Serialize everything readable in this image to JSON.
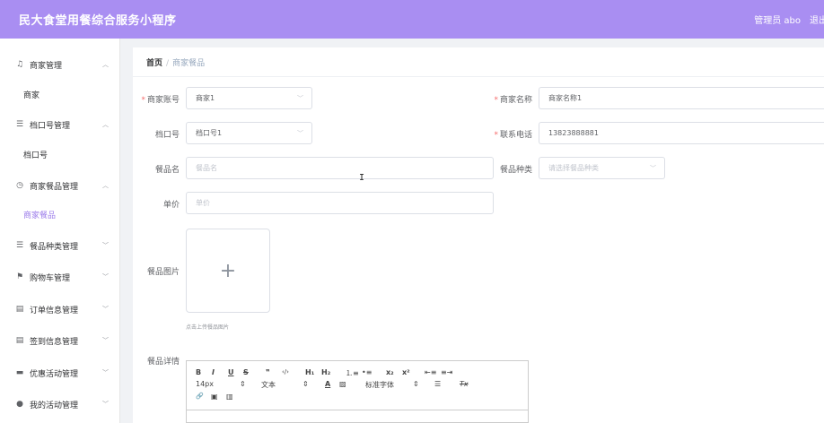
{
  "header": {
    "title": "民大食堂用餐综合服务小程序",
    "user": "管理员 abo",
    "logout": "退出"
  },
  "sidebar": {
    "items": [
      {
        "label": "商家管理",
        "icon": "bell-icon",
        "glyph": "♫",
        "arrow": "︿"
      },
      {
        "label": "档口号管理",
        "icon": "menu-icon",
        "glyph": "☰",
        "arrow": "︿"
      },
      {
        "label": "商家餐品管理",
        "icon": "clock-icon",
        "glyph": "◷",
        "arrow": "︿"
      },
      {
        "label": "餐品种类管理",
        "icon": "list-icon",
        "glyph": "☰",
        "arrow": "﹀"
      },
      {
        "label": "购物车管理",
        "icon": "flag-icon",
        "glyph": "⚑",
        "arrow": "﹀"
      },
      {
        "label": "订单信息管理",
        "icon": "document-icon",
        "glyph": "▤",
        "arrow": "﹀"
      },
      {
        "label": "签到信息管理",
        "icon": "checkin-icon",
        "glyph": "▤",
        "arrow": "﹀"
      },
      {
        "label": "优惠活动管理",
        "icon": "coupon-icon",
        "glyph": "▬",
        "arrow": "﹀"
      },
      {
        "label": "我的活动管理",
        "icon": "location-icon",
        "glyph": "●",
        "arrow": "﹀"
      }
    ],
    "subitems": {
      "merchant": "商家",
      "stall": "档口号",
      "merchant_dish": "商家餐品"
    }
  },
  "breadcrumb": {
    "home": "首页",
    "separator": "/",
    "current": "商家餐品"
  },
  "form": {
    "merchant_account": {
      "label": "商家账号",
      "value": "商家1"
    },
    "merchant_name": {
      "label": "商家名称",
      "value": "商家名称1"
    },
    "stall_no": {
      "label": "档口号",
      "value": "档口号1"
    },
    "phone": {
      "label": "联系电话",
      "value": "13823888881"
    },
    "dish_name": {
      "label": "餐品名",
      "placeholder": "餐品名"
    },
    "dish_category": {
      "label": "餐品种类",
      "placeholder": "请选择餐品种类"
    },
    "price": {
      "label": "单价",
      "placeholder": "单价"
    },
    "dish_image": {
      "label": "餐品图片",
      "plus": "+",
      "tip": "点击上传餐品图片"
    },
    "dish_detail": {
      "label": "餐品详情"
    }
  },
  "editor_toolbar": {
    "bold": "B",
    "italic": "I",
    "underline": "U",
    "strike": "S",
    "quote": "❞",
    "code": "‹/›",
    "h1": "H₁",
    "h2": "H₂",
    "ordered_list": "⒈≡",
    "bullet_list": "•≡",
    "subscript": "x₂",
    "superscript": "x²",
    "indent_left": "⇤≡",
    "indent_right": "≡⇥",
    "font_size": "14px",
    "size_arrow": "⇕",
    "text_type": "文本",
    "type_arrow": "⇕",
    "font_color": "A",
    "bg_color": "▨",
    "font_family": "标准字体",
    "family_arrow": "⇕",
    "align": "☰",
    "clear_format": "Tx",
    "link": "🔗",
    "image": "▣",
    "video": "▥"
  }
}
